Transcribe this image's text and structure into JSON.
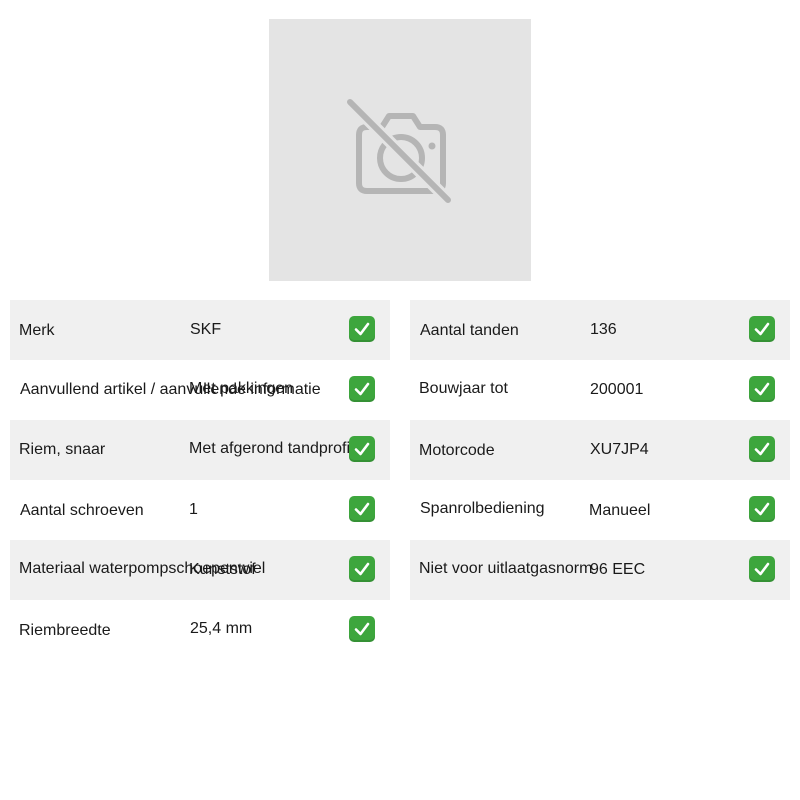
{
  "image": {
    "icon": "camera-off-icon"
  },
  "colors": {
    "placeholder_bg": "#e4e4e4",
    "icon_gray": "#b5b5b5",
    "row_shaded": "#f0f0f0",
    "check_green": "#3da63d"
  },
  "specs_left": [
    {
      "label": "Merk",
      "value": "SKF"
    },
    {
      "label": "Aanvullend artikel / aanvullende informatie",
      "value": "Met pakkingen"
    },
    {
      "label": "Riem, snaar",
      "value": "Met afgerond tandprofiel"
    },
    {
      "label": "Aantal schroeven",
      "value": "1"
    },
    {
      "label": "Materiaal waterpompschoepenwiel",
      "value": "Kunststof"
    },
    {
      "label": "Riembreedte",
      "value": "25,4 mm"
    }
  ],
  "specs_right": [
    {
      "label": "Aantal tanden",
      "value": "136"
    },
    {
      "label": "Bouwjaar tot",
      "value": "200001"
    },
    {
      "label": "Motorcode",
      "value": "XU7JP4"
    },
    {
      "label": "Spanrolbediening",
      "value": "Manueel"
    },
    {
      "label": "Niet voor uitlaatgasnorm",
      "value": "96 EEC"
    }
  ]
}
